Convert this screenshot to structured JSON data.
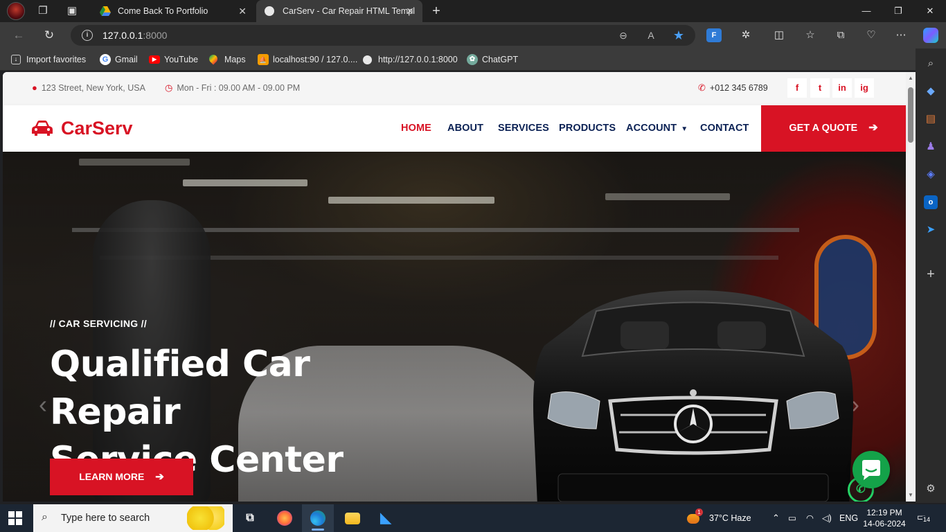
{
  "browser": {
    "tabs": [
      {
        "title": "Come Back To Portfolio",
        "active": false
      },
      {
        "title": "CarServ - Car Repair HTML Templ",
        "active": true
      }
    ],
    "url": {
      "host": "127.0.0.1",
      "port": ":8000"
    },
    "favorites": [
      {
        "label": "Import favorites",
        "icon": "import-icon"
      },
      {
        "label": "Gmail",
        "icon": "google-icon"
      },
      {
        "label": "YouTube",
        "icon": "youtube-icon"
      },
      {
        "label": "Maps",
        "icon": "maps-icon"
      },
      {
        "label": "localhost:90 / 127.0....",
        "icon": "phpmyadmin-icon"
      },
      {
        "label": "http://127.0.0.1:8000",
        "icon": "globe-icon"
      },
      {
        "label": "ChatGPT",
        "icon": "chatgpt-icon"
      }
    ]
  },
  "site": {
    "topbar": {
      "address": "123 Street, New York, USA",
      "hours": "Mon - Fri : 09.00 AM - 09.00 PM",
      "phone": "+012 345 6789",
      "social": [
        "f",
        "t",
        "in",
        "ig"
      ]
    },
    "brand": "CarServ",
    "nav": {
      "home": "HOME",
      "about": "ABOUT",
      "services": "SERVICES",
      "products": "PRODUCTS",
      "account": "ACCOUNT",
      "contact": "CONTACT",
      "quote": "GET A QUOTE"
    },
    "hero": {
      "eyebrow": "// CAR SERVICING //",
      "title_line1": "Qualified Car Repair",
      "title_line2": "Service Center",
      "cta": "LEARN MORE"
    }
  },
  "taskbar": {
    "search_placeholder": "Type here to search",
    "weather": "37°C  Haze",
    "weather_badge": "1",
    "language": "ENG",
    "time": "12:19 PM",
    "date": "14-06-2024",
    "notifications": "14"
  },
  "colors": {
    "accent": "#d81324",
    "navy": "#0b2154"
  }
}
